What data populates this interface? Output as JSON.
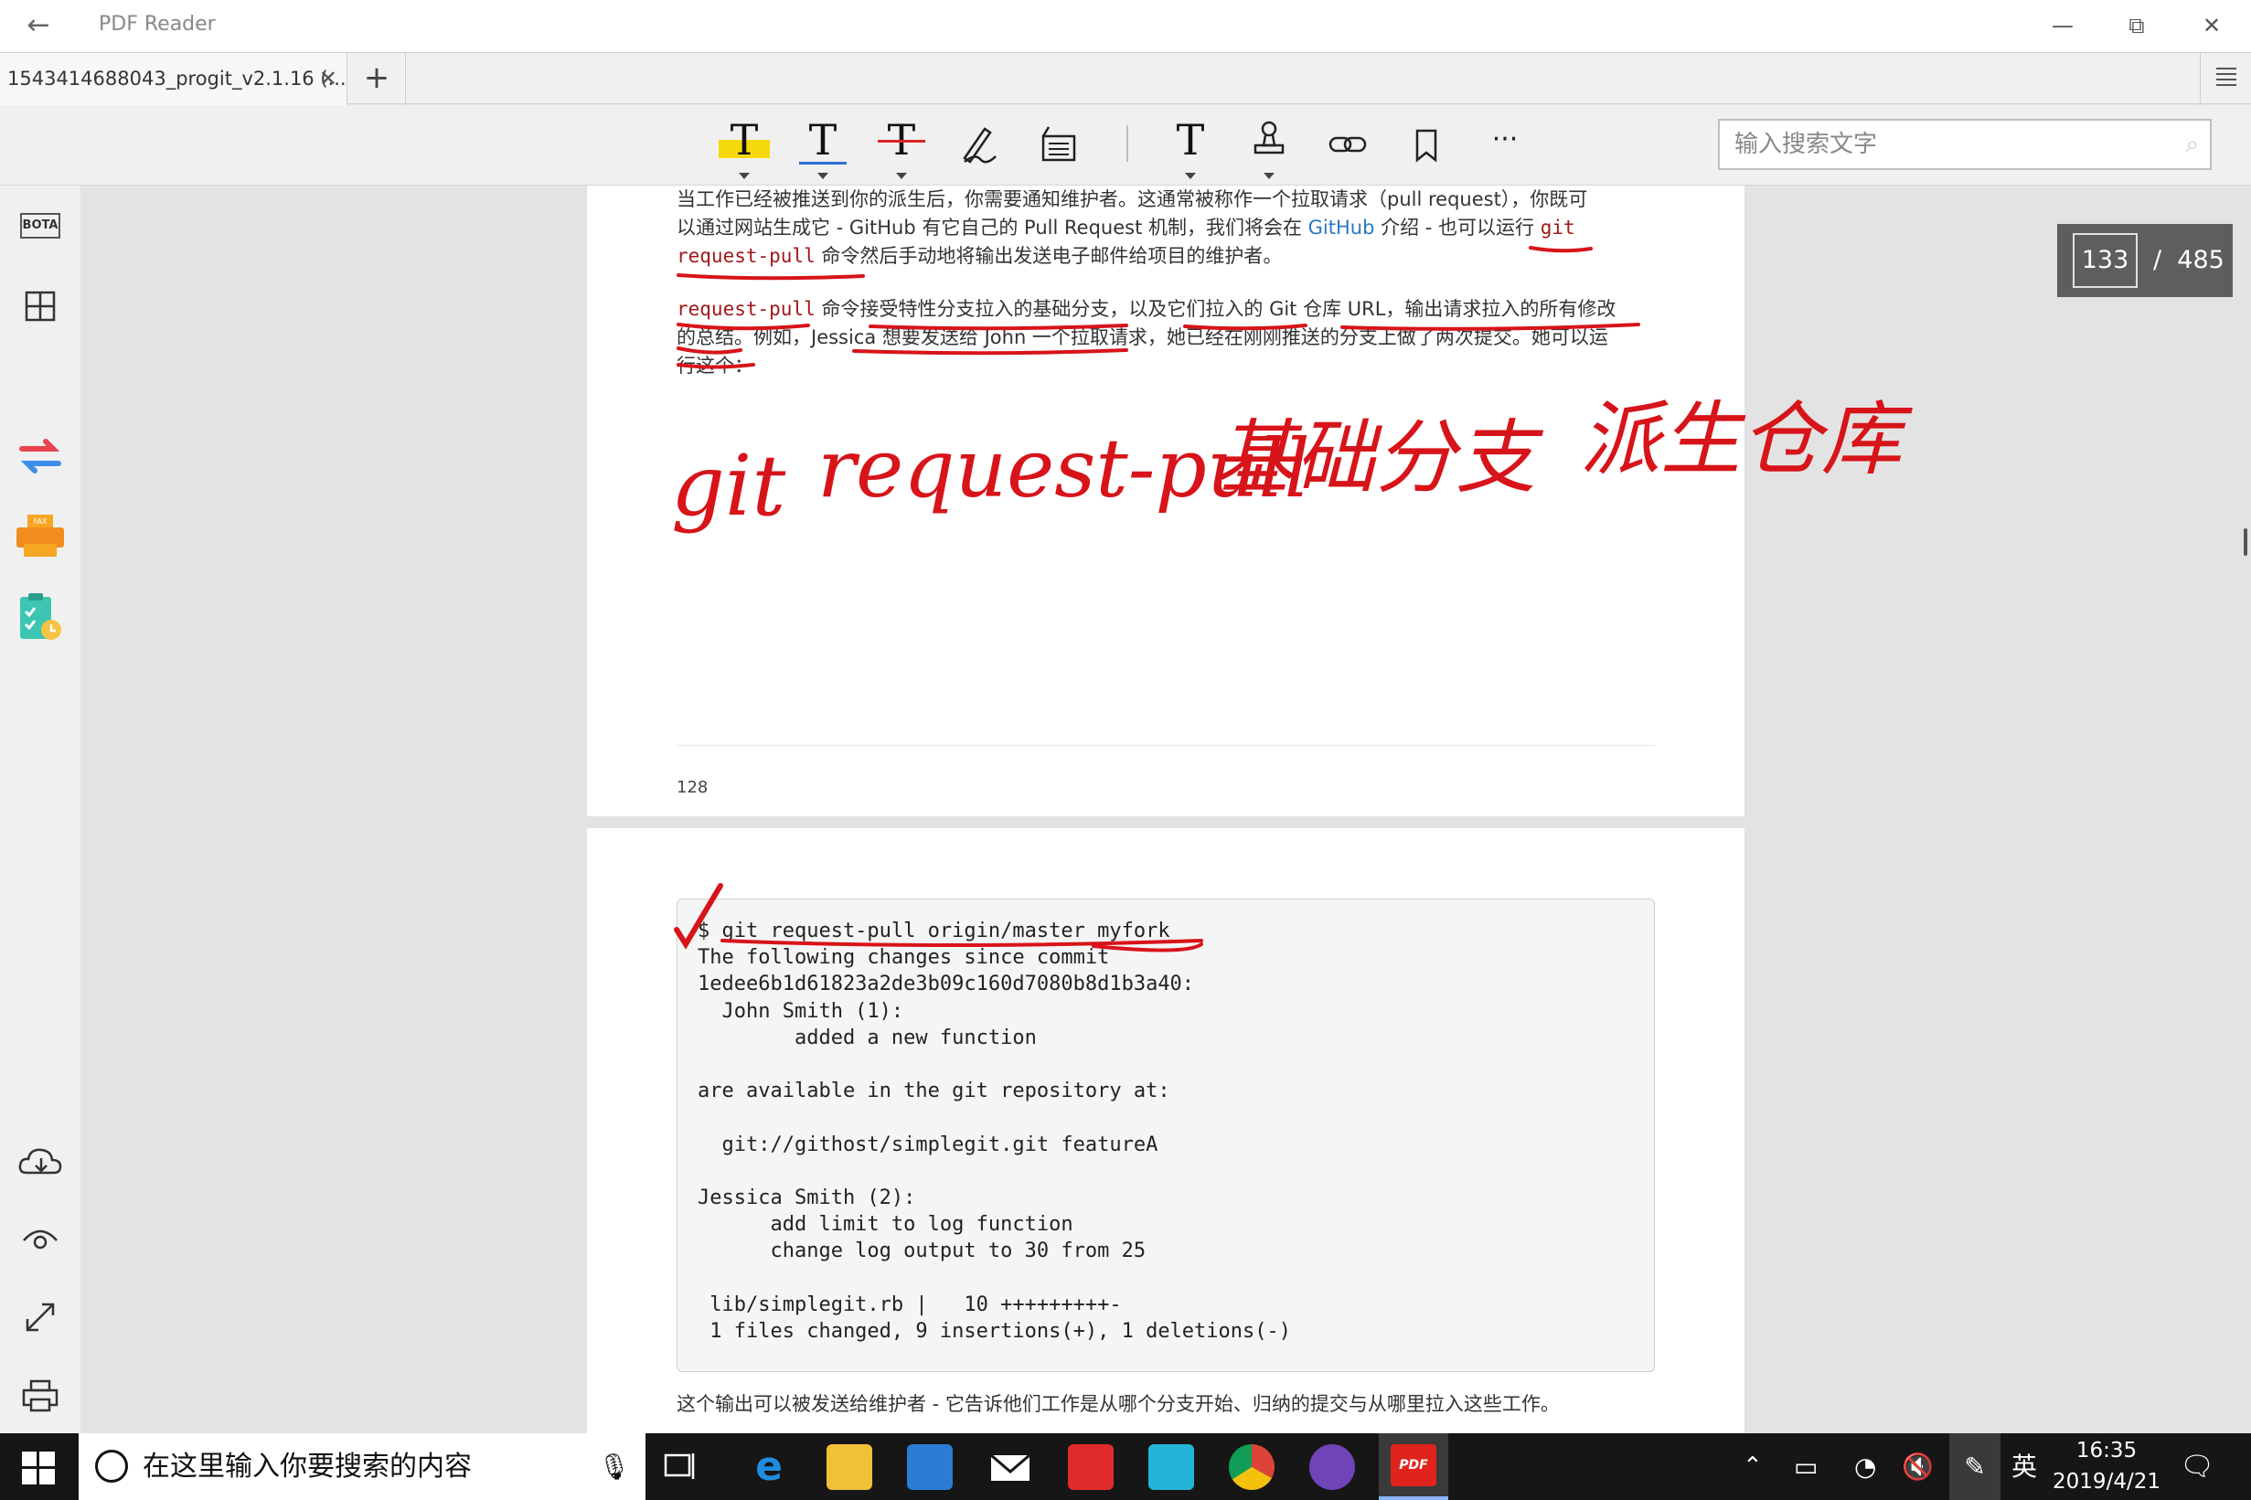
{
  "app": {
    "title": "PDF Reader"
  },
  "window_controls": {
    "minimize": "—",
    "restore": "⧉",
    "close": "✕"
  },
  "tabs": [
    {
      "label": "1543414688043_progit_v2.1.16 (..."
    }
  ],
  "tab_actions": {
    "close": "✕",
    "new_tab": "+"
  },
  "toolbar": {
    "tools": [
      "highlight-text",
      "underline-text",
      "strikethrough-text",
      "freehand-pen",
      "area-note",
      "add-text",
      "stamp",
      "link",
      "bookmark"
    ],
    "more": "···",
    "search_placeholder": "输入搜索文字"
  },
  "sidebar": {
    "bota_label": "BOTA"
  },
  "page_indicator": {
    "current": "133",
    "separator": "/",
    "total": "485"
  },
  "page_128": {
    "para1_line1": "当工作已经被推送到你的派生后，你需要通知维护者。这通常被称作一个拉取请求（pull request），你既可",
    "para1_line2_a": "以通过网站生成它 - GitHub 有它自己的 Pull Request 机制，我们将会在 ",
    "para1_line2_link": "GitHub",
    "para1_line2_b": " 介绍 - 也可以运行 ",
    "para1_line2_code": "git",
    "para1_line3_code": "request-pull",
    "para1_line3_b": " 命令然后手动地将输出发送电子邮件给项目的维护者。",
    "para2_line1_code": "request-pull",
    "para2_line1_b": " 命令接受特性分支拉入的基础分支，以及它们拉入的 Git 仓库 URL，输出请求拉入的所有修改",
    "para2_line2": "的总结。例如，Jessica 想要发送给 John 一个拉取请求，她已经在刚刚推送的分支上做了两次提交。她可以运",
    "para2_line3": "行这个：",
    "page_number": "128"
  },
  "annotations": {
    "handwritten_1": "git",
    "handwritten_2": "request-pull",
    "handwritten_3": "基础分支",
    "handwritten_4": "派生仓库",
    "check_mark": "✓"
  },
  "page_129": {
    "code_block": "$ git request-pull origin/master myfork\nThe following changes since commit\n1edee6b1d61823a2de3b09c160d7080b8d1b3a40:\n  John Smith (1):\n        added a new function\n\nare available in the git repository at:\n\n  git://githost/simplegit.git featureA\n\nJessica Smith (2):\n      add limit to log function\n      change log output to 30 from 25\n\n lib/simplegit.rb |   10 +++++++++-\n 1 files changed, 9 insertions(+), 1 deletions(-)",
    "after_text": "这个输出可以被发送给维护者 - 它告诉他们工作是从哪个分支开始、归纳的提交与从哪里拉入这些工作。"
  },
  "taskbar": {
    "search_placeholder": "在这里输入你要搜索的内容",
    "ime": "英",
    "time": "16:35",
    "date": "2019/4/21"
  }
}
